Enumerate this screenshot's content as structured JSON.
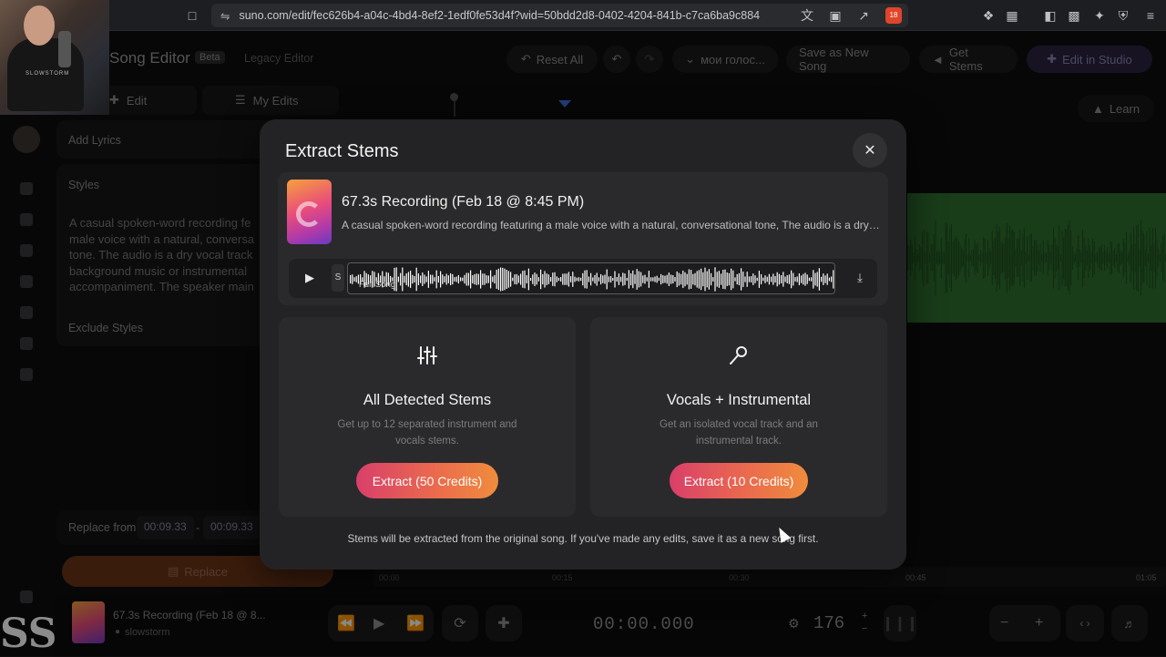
{
  "browser": {
    "url": "suno.com/edit/fec626b4-a04c-4bd4-8ef2-1edf0fe53d4f?wid=50bdd2d8-0402-4204-841b-c7ca6ba9c884",
    "extension_badge": "18"
  },
  "webcam": {
    "shirt_text": "SLOWSTORM"
  },
  "header": {
    "title": "Song Editor",
    "beta": "Beta",
    "legacy": "Legacy Editor",
    "reset_all": "Reset All",
    "voice_select": "мои голос...",
    "save_as_new": "Save as New Song",
    "get_stems": "Get Stems",
    "edit_in_studio": "Edit in Studio",
    "learn": "Learn"
  },
  "left_panel": {
    "tab_edit": "Edit",
    "tab_my_edits": "My Edits",
    "add_lyrics": "Add Lyrics",
    "styles_label": "Styles",
    "styles_text": "A casual spoken-word recording fe male voice with a natural, conversa tone. The audio is a dry vocal track background music or instrumental accompaniment. The speaker main",
    "exclude_styles": "Exclude Styles",
    "replace_from": "Replace from",
    "replace_start": "00:09.33",
    "replace_dash": "-",
    "replace_end": "00:09.33",
    "replace_button": "Replace"
  },
  "ruler": {
    "ticks": [
      "00:00",
      "00:15",
      "00:30",
      "00:45",
      "01:05"
    ]
  },
  "bottom_bar": {
    "song_title": "67.3s Recording (Feb 18 @ 8...",
    "artist": "slowstorm",
    "timecode": "00:00.000",
    "bpm": "176",
    "bpm_plus": "+",
    "bpm_minus": "−"
  },
  "modal": {
    "title": "Extract Stems",
    "song_title": "67.3s Recording (Feb 18 @ 8:45 PM)",
    "song_desc": "A casual spoken-word recording featuring a male voice with a natural, conversational tone, The audio is a dry vo...",
    "s_label": "S",
    "wave_label": "Full Song",
    "option_all": {
      "title": "All Detected Stems",
      "desc": "Get up to 12 separated instrument and vocals stems.",
      "button": "Extract (50 Credits)"
    },
    "option_vocals": {
      "title": "Vocals + Instrumental",
      "desc": "Get an isolated vocal track and an instrumental track.",
      "button": "Extract (10 Credits)"
    },
    "footnote": "Stems will be extracted from the original song. If you've made any edits, save it as a new song first."
  },
  "colors": {
    "accent_gradient_start": "#d93f6a",
    "accent_gradient_end": "#f08c3d",
    "waveform_green": "#2e6e2e",
    "studio_purple": "#2a2340"
  }
}
